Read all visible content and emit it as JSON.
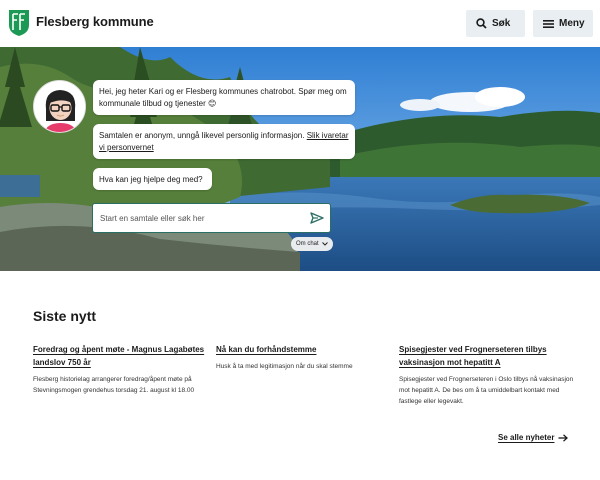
{
  "header": {
    "site_name": "Flesberg kommune",
    "search_label": "Søk",
    "menu_label": "Meny",
    "brand_color": "#1c9a55"
  },
  "chat": {
    "greeting": "Hei, jeg heter Kari og er Flesberg kommunes chatrobot. Spør meg om kommunale tilbud og tjenester 😊",
    "privacy_text": "Samtalen er anonym, unngå likevel personlig informasjon.",
    "privacy_link": "Slik ivaretar vi personvernet",
    "question": "Hva kan jeg hjelpe deg med?",
    "input_placeholder": "Start en samtale eller søk her",
    "about_label": "Om chat",
    "accent_color": "#2a6f64"
  },
  "news": {
    "title": "Siste nytt",
    "items": [
      {
        "headline": "Foredrag og åpent møte - Magnus Lagabøtes landslov 750 år",
        "summary": "Flesberg historielag arrangerer foredrag/åpent møte på Stevningsmogen grendehus torsdag 21. august kl 18.00"
      },
      {
        "headline": "Nå kan du forhåndstemme",
        "summary": "Husk å ta med legitimasjon når du skal stemme"
      },
      {
        "headline": "Spisegjester ved Frognerseteren tilbys vaksinasjon mot hepatitt A",
        "summary": "Spisegjester ved Frognerseteren i Oslo tilbys nå vaksinasjon mot hepatitt A. De bes om å ta umiddelbart kontakt med fastlege eller legevakt."
      }
    ],
    "see_all": "Se alle nyheter"
  }
}
